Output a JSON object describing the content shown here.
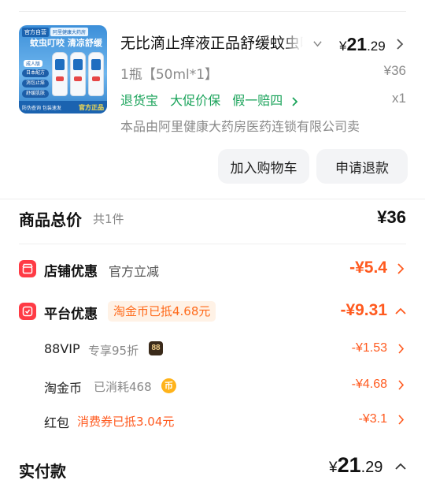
{
  "product": {
    "image_text": {
      "tag_official": "官方自营",
      "tag_store": "阿里健康大药房",
      "headline": "蚊虫叮咬  清凉舒缓",
      "kid": "成人版",
      "pill_1": "日本配方",
      "pill_2": "消包止痒",
      "pill_3": "舒缓肌肤",
      "foot_left": "防伪查询 包装速发",
      "official": "官方正品"
    },
    "title": "无比滴止痒液正品舒缓蚊虫叮咬",
    "price": {
      "currency": "¥",
      "integer": "21",
      "decimal": ".29"
    },
    "spec": "1瓶【50ml*1】",
    "original_price": "¥36",
    "services": [
      "退货宝",
      "大促价保",
      "假一赔四"
    ],
    "quantity": "x1",
    "seller_note": "本品由阿里健康大药房医药连锁有限公司卖"
  },
  "actions": {
    "add_to_cart": "加入购物车",
    "request_refund": "申请退款"
  },
  "total": {
    "label": "商品总价",
    "count": "共1件",
    "value": "¥36"
  },
  "store_discount": {
    "label": "店铺优惠",
    "sub": "官方立减",
    "value": "-¥5.4"
  },
  "platform_discount": {
    "label": "平台优惠",
    "tag": "淘金币已抵4.68元",
    "value": "-¥9.31",
    "items": [
      {
        "label": "88VIP",
        "note": "专享95折",
        "badge": "88",
        "value": "-¥1.53"
      },
      {
        "label": "淘金币",
        "note": "已消耗468",
        "badge": "币",
        "value": "-¥4.68"
      },
      {
        "label": "红包",
        "note": "消费券已抵3.04元",
        "value": "-¥3.1"
      }
    ]
  },
  "paid": {
    "label": "实付款",
    "currency": "¥",
    "integer": "21",
    "decimal": ".29"
  },
  "colors": {
    "discount": "#ff5a1f",
    "service_green": "#1aa35a",
    "icon_red": "#ff3b45",
    "coin_tag_bg": "#fff2e6"
  }
}
